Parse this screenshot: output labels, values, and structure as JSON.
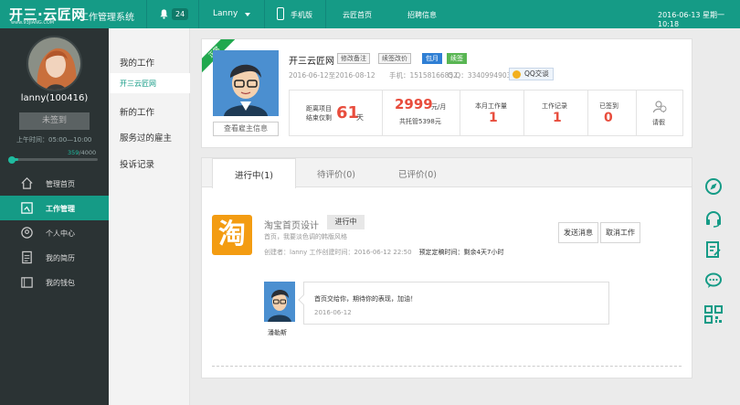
{
  "topbar": {
    "logo": "开三·云匠网",
    "logo_sub": "www.93JIANG.COM",
    "system_title": "工作管理系统",
    "notification_count": "24",
    "user": "Lanny",
    "mobile": "手机版",
    "nav_home": "云匠首页",
    "nav_jobs": "招聘信息",
    "datetime": "2016-06-13 星期一 10:18"
  },
  "sidebar": {
    "username": "lanny(100416)",
    "sign_button": "未签到",
    "work_time": "上午时间：05:00—10:00",
    "progress_current": "359",
    "progress_total": "/4000",
    "progress_fraction": 0.09,
    "items": [
      {
        "label": "管理首页"
      },
      {
        "label": "工作管理"
      },
      {
        "label": "个人中心"
      },
      {
        "label": "我的简历"
      },
      {
        "label": "我的钱包"
      }
    ]
  },
  "submenu": {
    "title": "我的工作",
    "active": "开三云匠网",
    "items": [
      "新的工作",
      "服务过的雇主",
      "投诉记录"
    ]
  },
  "employer": {
    "ribbon": "正常",
    "view_button": "查看雇主信息",
    "name": "开三云匠网",
    "tag_edit_remark": "修改备注",
    "tag_renew": "续签改价",
    "tag_monthly": "包月",
    "tag_renewed": "续签",
    "date_range": "2016-06-12至2016-08-12",
    "phone": "手机：15158166852",
    "qq_number": "Q.Q：3340994903",
    "qq_button": "QQ交谈",
    "stats": {
      "countdown_label1": "距离项目",
      "countdown_label2": "结束仅剩",
      "countdown_days": "61",
      "countdown_unit": "天",
      "salary": "2999",
      "salary_unit": "元/月",
      "total_label": "共托管5398元",
      "month_workload_label": "本月工作量",
      "month_workload": "1",
      "work_records_label": "工作记录",
      "work_records": "1",
      "signed_label": "已签到",
      "signed": "0",
      "leave_label": "请假"
    }
  },
  "tabs": [
    {
      "label": "进行中(1)"
    },
    {
      "label": "待评价(0)"
    },
    {
      "label": "已评价(0)"
    }
  ],
  "job": {
    "icon_char": "淘",
    "title": "淘宝首页设计",
    "status": "进行中",
    "description": "首页，我要淡色调的韩版风格",
    "creator": "创建者：lanny 工作创建时间：2016-06-12 22:50",
    "deadline": "预定定稿时间：剩余4天7小时",
    "send_message": "发送消息",
    "cancel_job": "取消工作"
  },
  "message": {
    "sender": "潘勒斯",
    "text": "首页交给你，期待你的表现，加油！",
    "date": "2016-06-12"
  },
  "right_icons": [
    "compass-icon",
    "headset-icon",
    "edit-doc-icon",
    "chat-bubble-icon",
    "qr-code-icon"
  ],
  "colors": {
    "brand": "#159b86",
    "sidebar": "#2b3334",
    "accent_red": "#e84d3d"
  }
}
